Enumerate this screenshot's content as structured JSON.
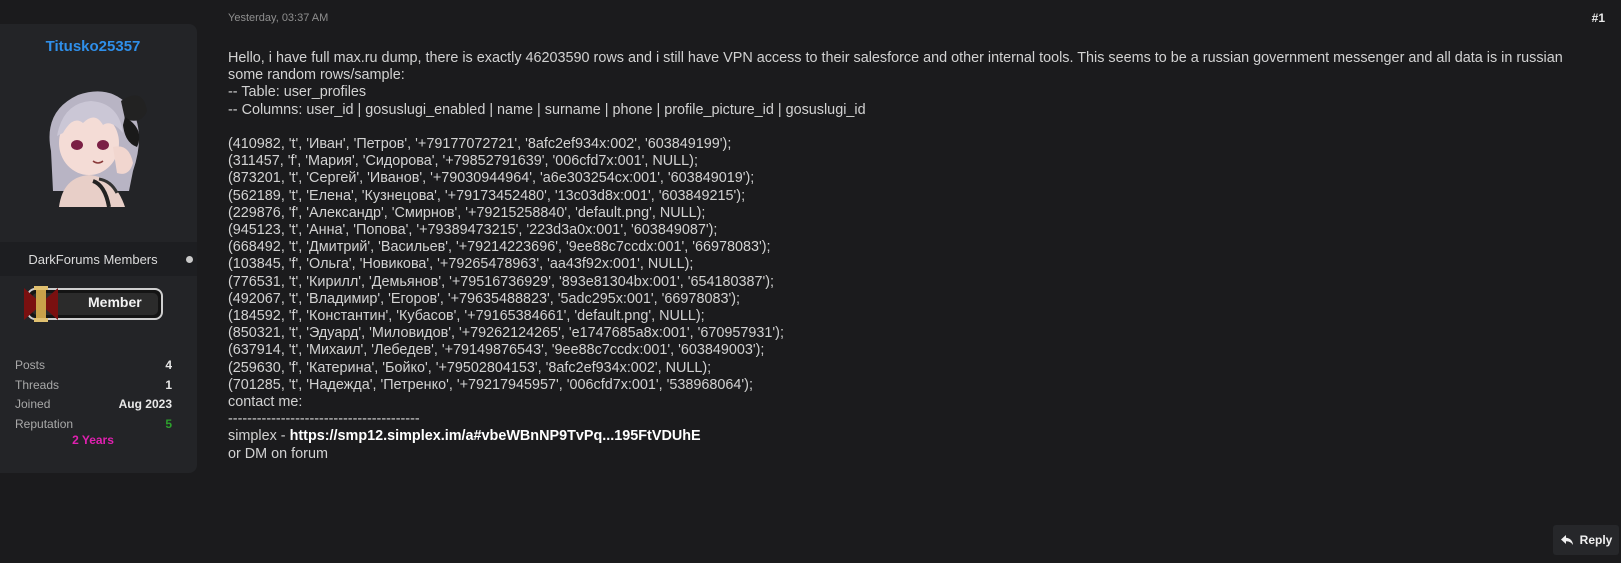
{
  "user": {
    "username": "Titusko25357",
    "group": "DarkForums Members",
    "rank_label": "Member",
    "stats": [
      {
        "label": "Posts",
        "value": "4"
      },
      {
        "label": "Threads",
        "value": "1"
      },
      {
        "label": "Joined",
        "value": "Aug 2023"
      },
      {
        "label": "Reputation",
        "value": "5"
      }
    ],
    "tenure": "2 Years"
  },
  "post": {
    "timestamp": "Yesterday, 03:37 AM",
    "number": "#1",
    "lines": [
      "Hello, i have full max.ru dump, there is exactly 46203590 rows and i still have VPN access to their salesforce and other internal tools. This seems to be a russian government messenger and all data is in russian",
      "some random rows/sample:",
      "-- Table: user_profiles",
      "-- Columns: user_id | gosuslugi_enabled | name | surname | phone | profile_picture_id | gosuslugi_id",
      "",
      "(410982, 't', 'Иван', 'Петров', '+79177072721', '8afc2ef934x:002', '603849199');",
      "(311457, 'f', 'Мария', 'Сидорова', '+79852791639', '006cfd7x:001', NULL);",
      "(873201, 't', 'Сергей', 'Иванов', '+79030944964', 'a6e303254cx:001', '603849019');",
      "(562189, 't', 'Елена', 'Кузнецова', '+79173452480', '13c03d8x:001', '603849215');",
      "(229876, 'f', 'Александр', 'Смирнов', '+79215258840', 'default.png', NULL);",
      "(945123, 't', 'Анна', 'Попова', '+79389473215', '223d3a0x:001', '603849087');",
      "(668492, 't', 'Дмитрий', 'Васильев', '+79214223696', '9ee88c7ccdx:001', '66978083');",
      "(103845, 'f', 'Ольга', 'Новикова', '+79265478963', 'aa43f92x:001', NULL);",
      "(776531, 't', 'Кирилл', 'Демьянов', '+79516736929', '893e81304bx:001', '654180387');",
      "(492067, 't', 'Владимир', 'Егоров', '+79635488823', '5adc295x:001', '66978083');",
      "(184592, 'f', 'Константин', 'Кубасов', '+79165384661', 'default.png', NULL);",
      "(850321, 't', 'Эдуард', 'Миловидов', '+79262124265', 'e1747685a8x:001', '670957931');",
      "(637914, 't', 'Михаил', 'Лебедев', '+79149876543', '9ee88c7ccdx:001', '603849003');",
      "(259630, 'f', 'Катерина', 'Бойко', '+79502804153', '8afc2ef934x:002', NULL);",
      "(701285, 't', 'Надежда', 'Петренко', '+79217945957', '006cfd7x:001', '538968064');",
      "contact me:",
      "----------------------------------------"
    ],
    "contact_prefix": "simplex - ",
    "contact_link": "https://smp12.simplex.im/a#vbeWBnNP9TvPq...195FtVDUhE",
    "last_line": "or DM on forum"
  },
  "actions": {
    "reply_label": "Reply"
  },
  "colors": {
    "username": "#2f8fea",
    "tenure": "#e020b0",
    "reputation": "#2da02d",
    "background": "#1b1b1d"
  }
}
